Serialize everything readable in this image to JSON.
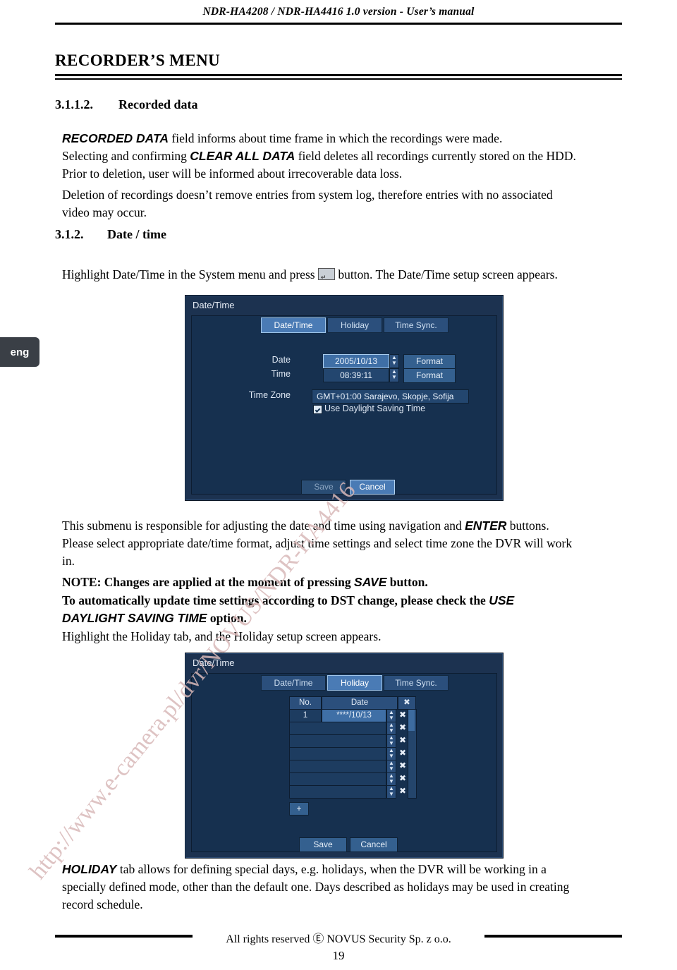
{
  "header": {
    "running_head": "NDR-HA4208 / NDR-HA4416 1.0 version - User’s manual"
  },
  "section": {
    "title": "RECORDER’S MENU"
  },
  "subsections": [
    {
      "number": "3.1.1.2.",
      "title": "Recorded data"
    },
    {
      "number": "3.1.2.",
      "title": "Date / time"
    }
  ],
  "body": {
    "p1_line1_a": "RECORDED DATA",
    "p1_line1_b": " field informs about time frame in which the recordings were made.",
    "p1_line2_a": "Selecting and confirming ",
    "p1_line2_b": "CLEAR ALL DATA",
    "p1_line2_c": " field deletes all recordings currently stored on the HDD.",
    "p1_line3": "Prior to deletion, user will be informed about irrecoverable data loss.",
    "p1_line4": "Deletion of recordings doesn’t remove entries from system log, therefore entries with no associated",
    "p1_line5": "video may occur.",
    "p2_a": "Highlight Date/Time in the System menu and press ",
    "p2_b": " button. The Date/Time setup screen appears.",
    "p3_a": "This submenu is responsible for adjusting the date and time using navigation and ",
    "p3_b": "ENTER",
    "p3_c": " buttons.",
    "p3_line2": "Please select appropriate date/time format, adjust time settings and select time zone the DVR will work",
    "p3_line3": "in.",
    "note_a": "NOTE: Changes are applied at the moment of pressing ",
    "note_b": "SAVE",
    "note_c": " button.",
    "p4_a": "To automatically update time settings according to DST change, please check the ",
    "p4_b": "USE",
    "p4_c": "DAYLIGHT SAVING TIME",
    "p4_d": " option.",
    "p5": "Highlight the Holiday tab, and the Holiday setup screen appears.",
    "p6_a": "HOLIDAY",
    "p6_b": " tab allows for defining special days, e.g. holidays, when the DVR will be working in a",
    "p6_line2": "specially defined mode, other than the default one. Days described as holidays may be used in creating",
    "p6_line3": "record schedule."
  },
  "eng_tab": "eng",
  "watermark": {
    "text_left": "http://www.e-camera.pl/dvr/NOVUS/NDR-HA4416"
  },
  "dialog_datetime": {
    "window_title": "Date/Time",
    "tabs": [
      {
        "label": "Date/Time",
        "selected": true
      },
      {
        "label": "Holiday",
        "selected": false
      },
      {
        "label": "Time Sync.",
        "selected": false
      }
    ],
    "fields": [
      {
        "label": "Date",
        "value": "2005/10/13",
        "button": "Format"
      },
      {
        "label": "Time",
        "value": "08:39:11",
        "button": "Format"
      },
      {
        "label": "Time Zone",
        "value": "GMT+01:00  Sarajevo, Skopje, Sofija",
        "button": ""
      }
    ],
    "checkbox": {
      "label": "Use Daylight Saving Time",
      "checked": true
    },
    "buttons": [
      {
        "label": "Save",
        "state": "dim"
      },
      {
        "label": "Cancel",
        "state": "selected"
      }
    ]
  },
  "dialog_holiday": {
    "window_title": "Date/Time",
    "tabs": [
      {
        "label": "Date/Time",
        "selected": false
      },
      {
        "label": "Holiday",
        "selected": true
      },
      {
        "label": "Time Sync.",
        "selected": false
      }
    ],
    "table": {
      "headers": [
        "No.",
        "Date",
        "✖"
      ],
      "rows": [
        {
          "no": "1",
          "date": "****/10/13",
          "del": "✖"
        },
        {
          "no": "",
          "date": "",
          "del": "✖"
        },
        {
          "no": "",
          "date": "",
          "del": "✖"
        },
        {
          "no": "",
          "date": "",
          "del": "✖"
        },
        {
          "no": "",
          "date": "",
          "del": "✖"
        },
        {
          "no": "",
          "date": "",
          "del": "✖"
        },
        {
          "no": "",
          "date": "",
          "del": "✖"
        }
      ]
    },
    "add_button": "+",
    "buttons": [
      {
        "label": "Save",
        "state": "normal"
      },
      {
        "label": "Cancel",
        "state": "normal"
      }
    ]
  },
  "footer": {
    "copyright": "All rights reserved Ⓔ NOVUS Security Sp. z o.o.",
    "page_number": "19"
  }
}
